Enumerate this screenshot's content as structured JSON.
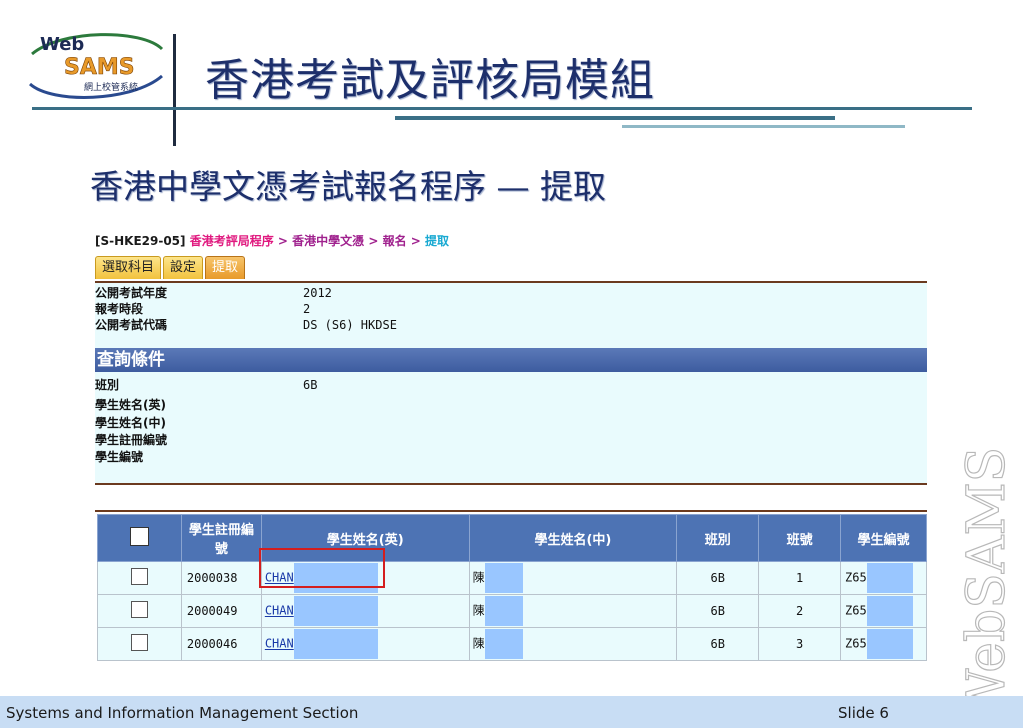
{
  "logo": {
    "top": "Web",
    "main": "SAMS",
    "sub": "網上校管系統"
  },
  "slide_title": "香港考試及評核局模組",
  "sub_title": "香港中學文憑考試報名程序 — 提取",
  "breadcrumb": {
    "code": "[S-HKE29-05]",
    "part1": "香港考評局程序",
    "sep1": " > ",
    "part2": "香港中學文憑",
    "sep2": " > ",
    "part3": "報名",
    "sep3": " > ",
    "part4": "提取"
  },
  "tabs": [
    {
      "label": "選取科目"
    },
    {
      "label": "設定"
    },
    {
      "label": "提取"
    }
  ],
  "info": {
    "year_label": "公開考試年度",
    "year_value": "2012",
    "phase_label": "報考時段",
    "phase_value": "2",
    "code_label": "公開考試代碼",
    "code_value": "DS (S6) HKDSE"
  },
  "query": {
    "header": "查詢條件",
    "class_label": "班別",
    "class_value": "6B",
    "name_en_label": "學生姓名(英)",
    "name_zh_label": "學生姓名(中)",
    "reg_label": "學生註冊編號",
    "stu_no_label": "學生編號"
  },
  "table": {
    "headers": [
      "學生註冊編號",
      "學生姓名(英)",
      "學生姓名(中)",
      "班別",
      "班號",
      "學生編號"
    ],
    "rows": [
      {
        "reg": "2000038",
        "name_en": "CHAN",
        "name_zh": "陳",
        "class": "6B",
        "class_no": "1",
        "stu_no": "Z65"
      },
      {
        "reg": "2000049",
        "name_en": "CHAN",
        "name_zh": "陳",
        "class": "6B",
        "class_no": "2",
        "stu_no": "Z65"
      },
      {
        "reg": "2000046",
        "name_en": "CHAN",
        "name_zh": "陳",
        "class": "6B",
        "class_no": "3",
        "stu_no": "Z65"
      }
    ]
  },
  "watermark": "WebSAMS",
  "footer": {
    "left": "Systems and Information Management Section",
    "right": "Slide 6"
  },
  "colors": {
    "title": "#1d2f6b",
    "table_header": "#4d73b4",
    "panel_bg": "#e9fbfd",
    "highlight": "#d41e1e"
  }
}
